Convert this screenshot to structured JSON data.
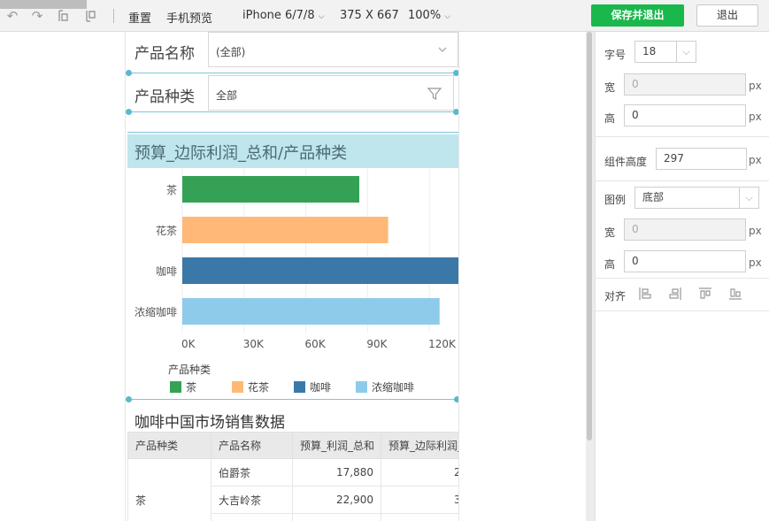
{
  "toolbar": {
    "reset_label": "重置",
    "preview_label": "手机预览",
    "device_label": "iPhone 6/7/8",
    "resolution": "375 X 667",
    "zoom": "100%",
    "save_label": "保存并退出",
    "exit_label": "退出"
  },
  "filters": [
    {
      "label": "产品名称",
      "value": "(全部)",
      "icon": "chevron-down-icon"
    },
    {
      "label": "产品种类",
      "value": "全部",
      "icon": "funnel-icon"
    }
  ],
  "chart_section": {
    "title": "预算_边际利润_总和/产品种类"
  },
  "chart_data": {
    "type": "bar",
    "orientation": "horizontal",
    "categories": [
      "茶",
      "花茶",
      "咖啡",
      "浓缩咖啡"
    ],
    "values": [
      86000,
      100000,
      138000,
      125000
    ],
    "colors": [
      "#35a154",
      "#ffb877",
      "#3a78a8",
      "#8ecbea"
    ],
    "x_ticks": [
      "0K",
      "30K",
      "60K",
      "90K",
      "120K"
    ],
    "xlim": [
      0,
      135000
    ],
    "legend_title": "产品种类",
    "legend_position": "bottom"
  },
  "table": {
    "title": "咖啡中国市场销售数据",
    "columns": [
      "产品种类",
      "产品名称",
      "预算_利润_总和",
      "预算_边际利润_总和"
    ],
    "group_label": "茶",
    "rows": [
      {
        "name": "伯爵茶",
        "profit": "17,880",
        "margin": "2"
      },
      {
        "name": "大吉岭茶",
        "profit": "22,900",
        "margin": "3"
      }
    ]
  },
  "panel": {
    "font_size_label": "字号",
    "font_size_value": "18",
    "width_label": "宽",
    "width_value": "0",
    "height_label": "高",
    "height_value": "0",
    "unit": "px",
    "component_height_label": "组件高度",
    "component_height_value": "297",
    "legend_label": "图例",
    "legend_value": "底部",
    "legend_width_label": "宽",
    "legend_width_value": "0",
    "legend_height_label": "高",
    "legend_height_value": "0",
    "align_label": "对齐"
  }
}
